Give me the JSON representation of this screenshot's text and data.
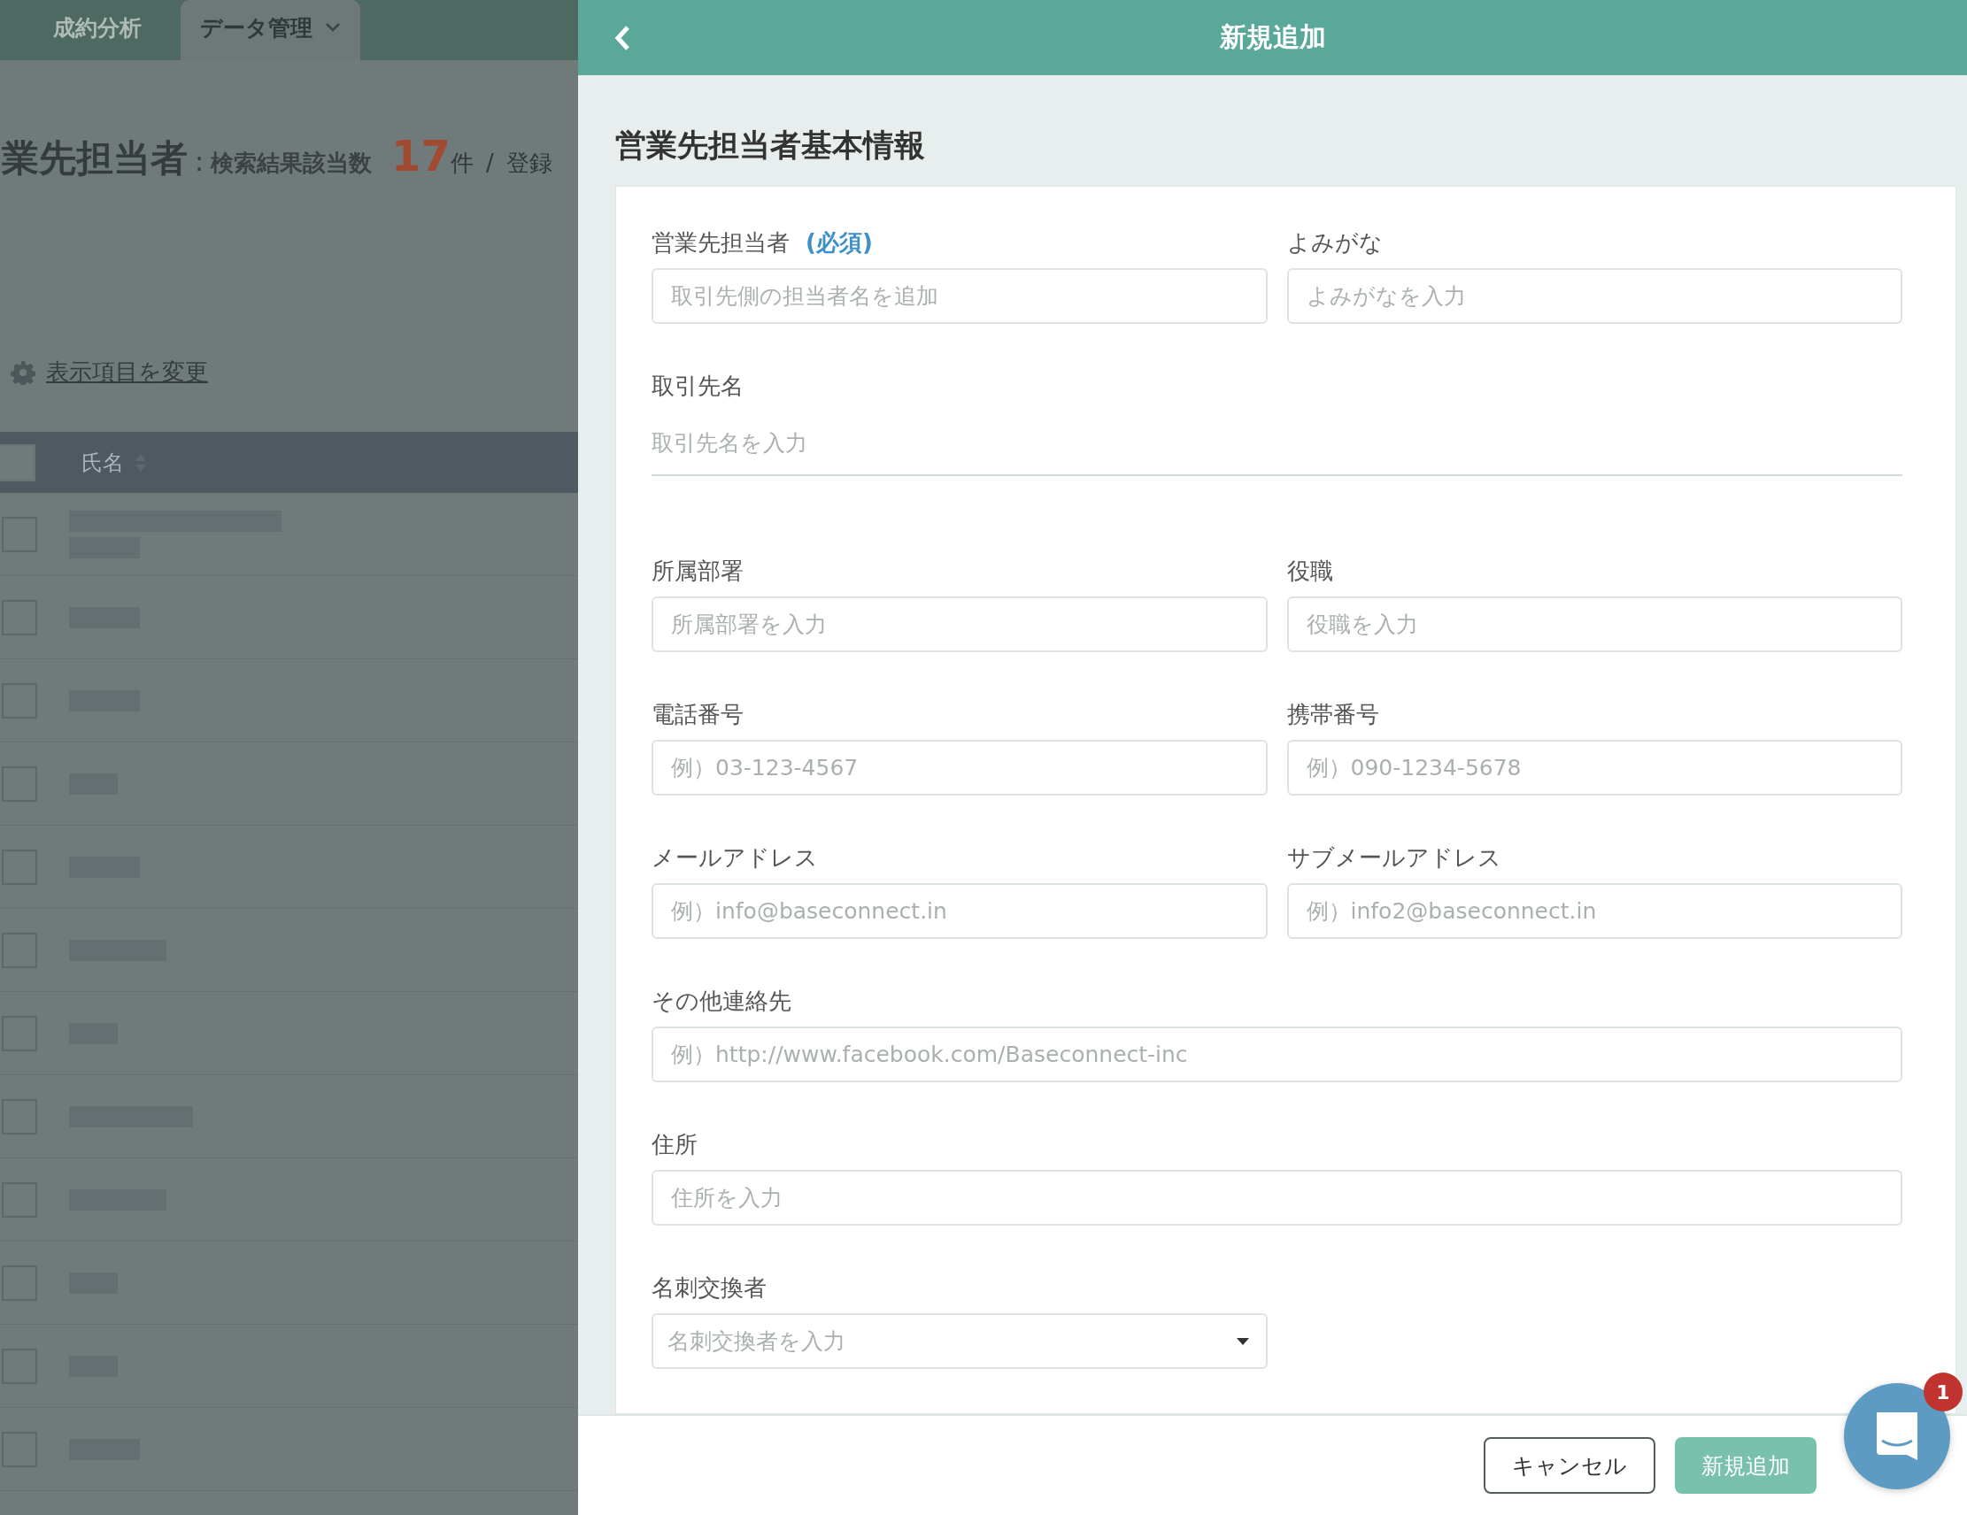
{
  "background": {
    "nav_tabs": [
      {
        "label": "成約分析",
        "selected": false,
        "dropdown": false
      },
      {
        "label": "データ管理",
        "selected": true,
        "dropdown": true
      }
    ],
    "heading": {
      "title": "業先担当者",
      "separator": ":",
      "count_label": "検索結果該当数",
      "count": "17",
      "unit": "件",
      "slash": "/",
      "total_label": "登録"
    },
    "settings_link": "表示項目を変更",
    "table": {
      "header_checked": false,
      "columns": [
        "氏名"
      ],
      "rows": [
        {
          "checked": false
        },
        {
          "checked": false
        },
        {
          "checked": false
        },
        {
          "checked": false
        },
        {
          "checked": false
        },
        {
          "checked": false
        },
        {
          "checked": false
        },
        {
          "checked": false
        },
        {
          "checked": false
        },
        {
          "checked": false
        },
        {
          "checked": false
        },
        {
          "checked": false
        }
      ]
    }
  },
  "panel": {
    "title": "新規追加",
    "section_title": "営業先担当者基本情報",
    "fields": [
      {
        "kind": "input",
        "label": "営業先担当者",
        "required_tag": "(必須)",
        "placeholder": "取引先側の担当者名を追加"
      },
      {
        "kind": "input",
        "label": "よみがな",
        "placeholder": "よみがなを入力"
      },
      {
        "kind": "underline",
        "label": "取引先名",
        "placeholder": "取引先名を入力"
      },
      {
        "kind": "input",
        "label": "所属部署",
        "placeholder": "所属部署を入力"
      },
      {
        "kind": "input",
        "label": "役職",
        "placeholder": "役職を入力"
      },
      {
        "kind": "input",
        "label": "電話番号",
        "placeholder": "例）03-123-4567"
      },
      {
        "kind": "input",
        "label": "携帯番号",
        "placeholder": "例）090-1234-5678"
      },
      {
        "kind": "input",
        "label": "メールアドレス",
        "placeholder": "例）info@baseconnect.in"
      },
      {
        "kind": "input",
        "label": "サブメールアドレス",
        "placeholder": "例）info2@baseconnect.in"
      },
      {
        "kind": "wide_input",
        "label": "その他連絡先",
        "placeholder": "例）http://www.facebook.com/Baseconnect-inc"
      },
      {
        "kind": "wide_input",
        "label": "住所",
        "placeholder": "住所を入力"
      },
      {
        "kind": "select",
        "label": "名刺交換者",
        "placeholder": "名刺交換者を入力"
      }
    ],
    "buttons": [
      {
        "kind": "secondary",
        "label": "キャンセル"
      },
      {
        "kind": "primary",
        "label": "新規追加"
      }
    ]
  },
  "chat": {
    "badge": "1"
  }
}
